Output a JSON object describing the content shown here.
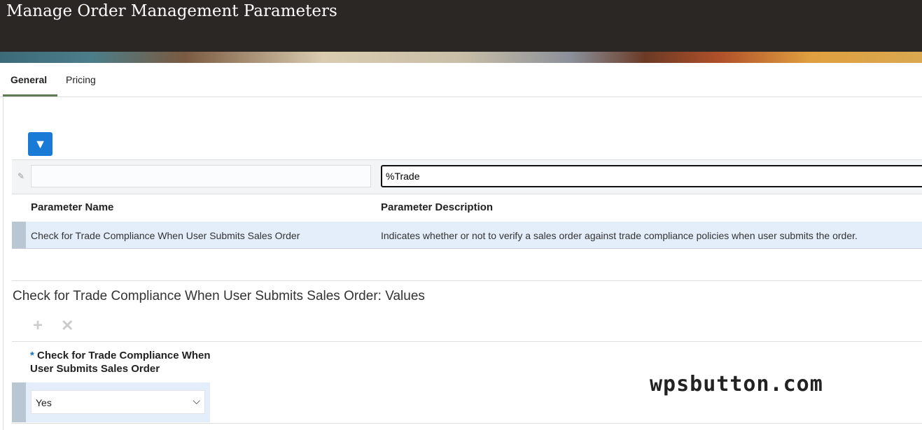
{
  "header": {
    "title": "Manage Order Management Parameters"
  },
  "tabs": [
    {
      "label": "General",
      "active": true
    },
    {
      "label": "Pricing",
      "active": false
    }
  ],
  "filter": {
    "icon": "query-by-example-icon",
    "name_value": "",
    "description_value": "%Trade"
  },
  "table": {
    "columns": [
      "Parameter Name",
      "Parameter Description"
    ],
    "rows": [
      {
        "name": "Check for Trade Compliance When User Submits Sales Order",
        "description": "Indicates whether or not to verify a sales order against trade compliance policies when user submits the order."
      }
    ]
  },
  "values": {
    "title": "Check for Trade Compliance When User Submits Sales Order: Values",
    "required_mark": "*",
    "column": "Check for Trade Compliance When User Submits Sales Order",
    "selected": "Yes"
  },
  "watermark": "wpsbutton.com",
  "colors": {
    "accent": "#1a7bd6",
    "tab_underline": "#5d7c54",
    "selected_row": "#e3eefa"
  }
}
